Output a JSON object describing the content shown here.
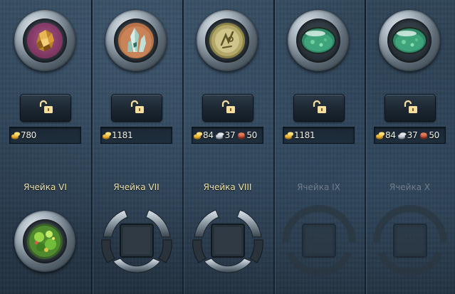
{
  "columns": [
    {
      "label": "Ячейка VI",
      "unlocked": true,
      "gem": "amber-gem-icon",
      "bottom_state": "filled",
      "bottom_gem": "green-crystal-icon",
      "costs": [
        {
          "icon": "gold-coins-icon",
          "value": "780"
        }
      ]
    },
    {
      "label": "Ячейка VII",
      "unlocked": true,
      "gem": "quartz-crystal-icon",
      "bottom_state": "open-frame",
      "costs": [
        {
          "icon": "gold-coins-icon",
          "value": "1181"
        }
      ]
    },
    {
      "label": "Ячейка VIII",
      "unlocked": true,
      "gem": "rune-stone-icon",
      "bottom_state": "open-frame",
      "costs": [
        {
          "icon": "gold-coins-icon",
          "value": "84"
        },
        {
          "icon": "silver-coins-icon",
          "value": "37"
        },
        {
          "icon": "copper-coins-icon",
          "value": "50"
        }
      ]
    },
    {
      "label": "Ячейка IX",
      "unlocked": false,
      "gem": "green-glass-orb-icon",
      "bottom_state": "faded-frame",
      "costs": [
        {
          "icon": "gold-coins-icon",
          "value": "1181"
        }
      ]
    },
    {
      "label": "Ячейка X",
      "unlocked": false,
      "gem": "green-glass-orb-icon",
      "bottom_state": "faded-frame",
      "costs": [
        {
          "icon": "gold-coins-icon",
          "value": "84"
        },
        {
          "icon": "silver-coins-icon",
          "value": "37"
        },
        {
          "icon": "copper-coins-icon",
          "value": "50"
        }
      ]
    }
  ],
  "colors": {
    "label_active": "#f0e4a8",
    "label_inactive": "#6e7c88",
    "gold": "#e9b53c",
    "silver": "#c9ccd0",
    "copper": "#c2563a"
  }
}
